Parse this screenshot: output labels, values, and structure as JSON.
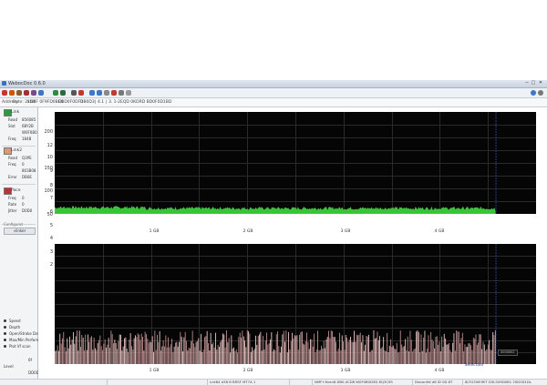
{
  "window": {
    "title": "WebocDoc 0.6.0"
  },
  "titlebar": {
    "min": "−",
    "max": "□",
    "close": "✕"
  },
  "toolbar": {
    "buttons": [
      {
        "name": "stop-icon",
        "color": "#c0392b"
      },
      {
        "name": "refresh-icon",
        "color": "#d35400"
      },
      {
        "name": "open-icon",
        "color": "#8e5a2b"
      },
      {
        "name": "record-icon",
        "color": "#a0322e"
      },
      {
        "name": "save-icon",
        "color": "#7a4a88"
      },
      {
        "name": "export-icon",
        "color": "#3c77c7"
      },
      {
        "name": "green-marker-icon",
        "color": "#2e8b3c"
      },
      {
        "name": "play-icon",
        "color": "#2e6b3c"
      },
      {
        "name": "settings-icon",
        "color": "#555555"
      },
      {
        "name": "target-icon",
        "color": "#c0392b"
      },
      {
        "name": "info-icon",
        "color": "#3c77c7"
      },
      {
        "name": "globe-icon",
        "color": "#3c77c7"
      },
      {
        "name": "doc-icon",
        "color": "#888888"
      },
      {
        "name": "alert-icon",
        "color": "#c0392b"
      },
      {
        "name": "zoom-icon",
        "color": "#777777"
      },
      {
        "name": "grid-icon",
        "color": "#999999"
      }
    ],
    "right_icons": [
      {
        "name": "help-icon",
        "color": "#3c77c7"
      },
      {
        "name": "about-icon",
        "color": "#777777"
      }
    ]
  },
  "address": {
    "parts": [
      "Address",
      "Byte: 2kbit",
      "1DBF 0F9FD0BE6",
      "D0D0F0DF0",
      "DB0D3",
      "| 4.1",
      "| 3. 1-2EQD 0KDRD BD0F0D1BD"
    ]
  },
  "left_panel": {
    "sections": [
      {
        "color": "#2e9a3e",
        "label": "Link",
        "rows": [
          [
            "Read",
            "856085"
          ],
          [
            "Slot",
            "6BY2B"
          ],
          [
            "",
            "W0F0B0"
          ],
          [
            "Freq",
            "184B"
          ]
        ]
      },
      {
        "color": "#d99a74",
        "label": "Link2",
        "rows": [
          [
            "Read",
            "Q3PE"
          ],
          [
            "Freq",
            "0"
          ],
          [
            "",
            "803B08"
          ],
          [
            "Error",
            "DB0E"
          ]
        ]
      },
      {
        "color": "#c0303a",
        "label": "Pace",
        "rows": [
          [
            "Freq",
            "0"
          ],
          [
            "Rate",
            "0"
          ],
          [
            "Jitter",
            "D0D0"
          ]
        ]
      }
    ],
    "button": "»linker",
    "group_label": "Configurat",
    "radios": [
      "Speed",
      "Depth",
      "Open/Stroke Data",
      "Max/Min Performance",
      "Plot Vf scan"
    ],
    "bottom": [
      [
        "",
        "6f"
      ],
      [
        "Level",
        ""
      ],
      [
        "",
        "DD0D"
      ]
    ]
  },
  "top_chart": {
    "ylabels": [
      "200",
      "150",
      "100",
      "50"
    ],
    "xlabels": [
      "1 GB",
      "2 GB",
      "3 GB",
      "4 GB"
    ]
  },
  "bottom_chart": {
    "ylabels": [
      "12",
      "10",
      "9",
      "8",
      "7",
      "6",
      "5",
      "4",
      "3",
      "2"
    ],
    "xlabels": [
      "1 GB",
      "2 GB",
      "3 GB",
      "4 GB"
    ],
    "marker_label": "Selection",
    "tooltip": "0000002"
  },
  "chart_data": [
    {
      "type": "area",
      "title": "",
      "ylim": [
        0,
        220
      ],
      "x_range_gb": [
        0,
        4.75
      ],
      "series": [
        {
          "color": "#37c437",
          "approx_level": 10
        }
      ]
    },
    {
      "type": "bar",
      "title": "",
      "ylim": [
        0,
        13
      ],
      "x_range_gb": [
        0,
        4.75
      ],
      "series": [
        {
          "color": "#d9a7a7",
          "approx_level": 3.5
        }
      ]
    }
  ],
  "status": [
    "",
    "",
    "Lnk84 d38 B BRSF MT7A 1",
    "",
    "NMF+6ven8  DB0.4CD8  W0F0B0D5D  8Q3C95",
    "Disconfdl d8  ID 0D 8T",
    "8LTG3I0E9ET  D3L5X9D0B1 2SD3D1DL"
  ],
  "colors": {
    "plot_bg": "#050505",
    "grid": "#2a2a2a",
    "green": "#37c437",
    "marker": "#2b3b86"
  }
}
